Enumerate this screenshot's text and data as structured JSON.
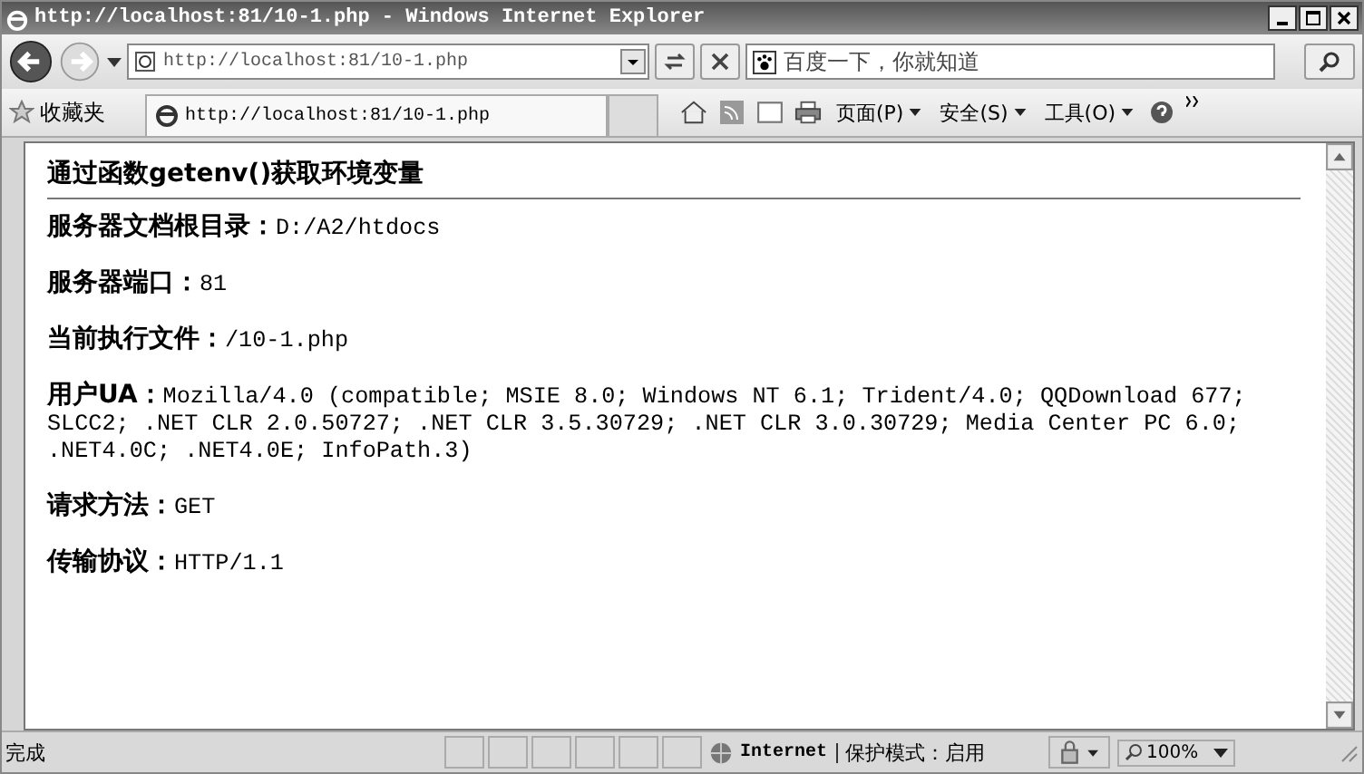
{
  "window": {
    "title": "http://localhost:81/10-1.php - Windows Internet Explorer"
  },
  "address_bar": {
    "value": "http://localhost:81/10-1.php"
  },
  "search": {
    "placeholder": "百度一下，你就知道"
  },
  "favorites": {
    "label": "收藏夹"
  },
  "tab": {
    "title": "http://localhost:81/10-1.php"
  },
  "command_menus": [
    "页面(P)",
    "安全(S)",
    "工具(O)"
  ],
  "page": {
    "heading": "通过函数getenv()获取环境变量",
    "items": [
      {
        "label": "服务器文档根目录：",
        "value": "D:/A2/htdocs"
      },
      {
        "label": "服务器端口：",
        "value": "81"
      },
      {
        "label": "当前执行文件：",
        "value": "/10-1.php"
      },
      {
        "label": "用户UA：",
        "value": "Mozilla/4.0 (compatible; MSIE 8.0; Windows NT 6.1; Trident/4.0; QQDownload 677; SLCC2; .NET CLR 2.0.50727; .NET CLR 3.5.30729; .NET CLR 3.0.30729; Media Center PC 6.0; .NET4.0C; .NET4.0E; InfoPath.3)"
      },
      {
        "label": "请求方法：",
        "value": "GET"
      },
      {
        "label": "传输协议：",
        "value": "HTTP/1.1"
      }
    ]
  },
  "status_bar": {
    "text": "完成",
    "zone": "Internet",
    "protected_mode": "保护模式：启用",
    "zoom": "100%"
  }
}
